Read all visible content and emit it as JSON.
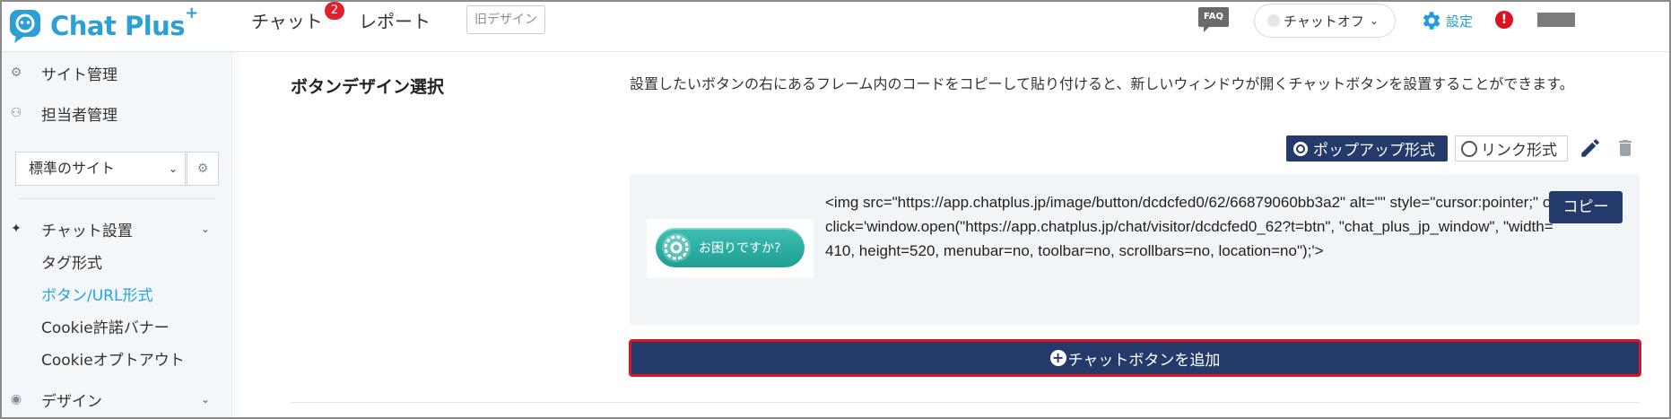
{
  "header": {
    "logo_text": "Chat Plus",
    "logo_plus": "+",
    "nav_chat": "チャット",
    "nav_chat_badge": "2",
    "nav_report": "レポート",
    "old_design": "旧デザイン",
    "faq": "FAQ",
    "chat_status": "チャットオフ",
    "settings": "設定",
    "alert": "!"
  },
  "sidebar": {
    "site_admin": "サイト管理",
    "agent_admin": "担当者管理",
    "site_select": "標準のサイト",
    "chat_setup": "チャット設置",
    "sub_items": [
      "タグ形式",
      "ボタン/URL形式",
      "Cookie許諾バナー",
      "Cookieオプトアウト"
    ],
    "active_index": 1,
    "design": "デザイン"
  },
  "main": {
    "section_title": "ボタンデザイン選択",
    "description": "設置したいボタンの右にあるフレーム内のコードをコピーして貼り付けると、新しいウィンドウが開くチャットボタンを設置することができます。",
    "radio_popup": "ポップアップ形式",
    "radio_link": "リンク形式",
    "selected_mode": "popup",
    "preview_button_label": "お困りですか?",
    "code": "<img src=\"https://app.chatplus.jp/image/button/dcdcfed0/62/66879060bb3a2\" alt=\"\" style=\"cursor:pointer;\" onclick='window.open(\"https://app.chatplus.jp/chat/visitor/dcdcfed0_62?t=btn\", \"chat_plus_jp_window\", \"width=410, height=520, menubar=no, toolbar=no, scrollbars=no, location=no\");'>",
    "copy_label": "コピー",
    "add_button_label": "チャットボタンを追加"
  },
  "colors": {
    "brand_blue": "#2b9fd6",
    "navy": "#233a6b",
    "highlight_red": "#e0141e",
    "link_active": "#25a3dc",
    "teal": "#2aaea2"
  }
}
